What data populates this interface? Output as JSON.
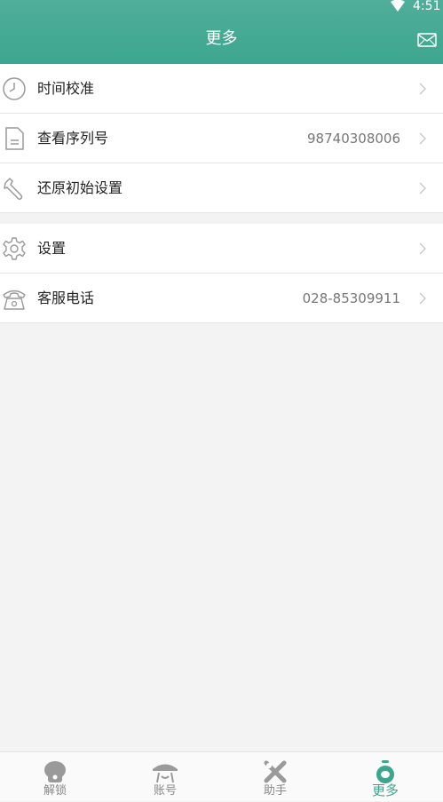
{
  "status_bar": {
    "time": "4:51"
  },
  "header": {
    "title": "更多"
  },
  "group1": [
    {
      "label": "时间校准",
      "value": ""
    },
    {
      "label": "查看序列号",
      "value": "98740308006"
    },
    {
      "label": "还原初始设置",
      "value": ""
    }
  ],
  "group2": [
    {
      "label": "设置",
      "value": ""
    },
    {
      "label": "客服电话",
      "value": "028-85309911"
    }
  ],
  "tabs": [
    {
      "label": "解锁",
      "icon": "unlock-icon"
    },
    {
      "label": "账号",
      "icon": "account-icon"
    },
    {
      "label": "助手",
      "icon": "assistant-icon"
    },
    {
      "label": "更多",
      "icon": "more-icon",
      "active": true
    }
  ],
  "colors": {
    "accent": "#3da68f",
    "background": "#f3f3f3",
    "icon_gray": "#999999"
  }
}
